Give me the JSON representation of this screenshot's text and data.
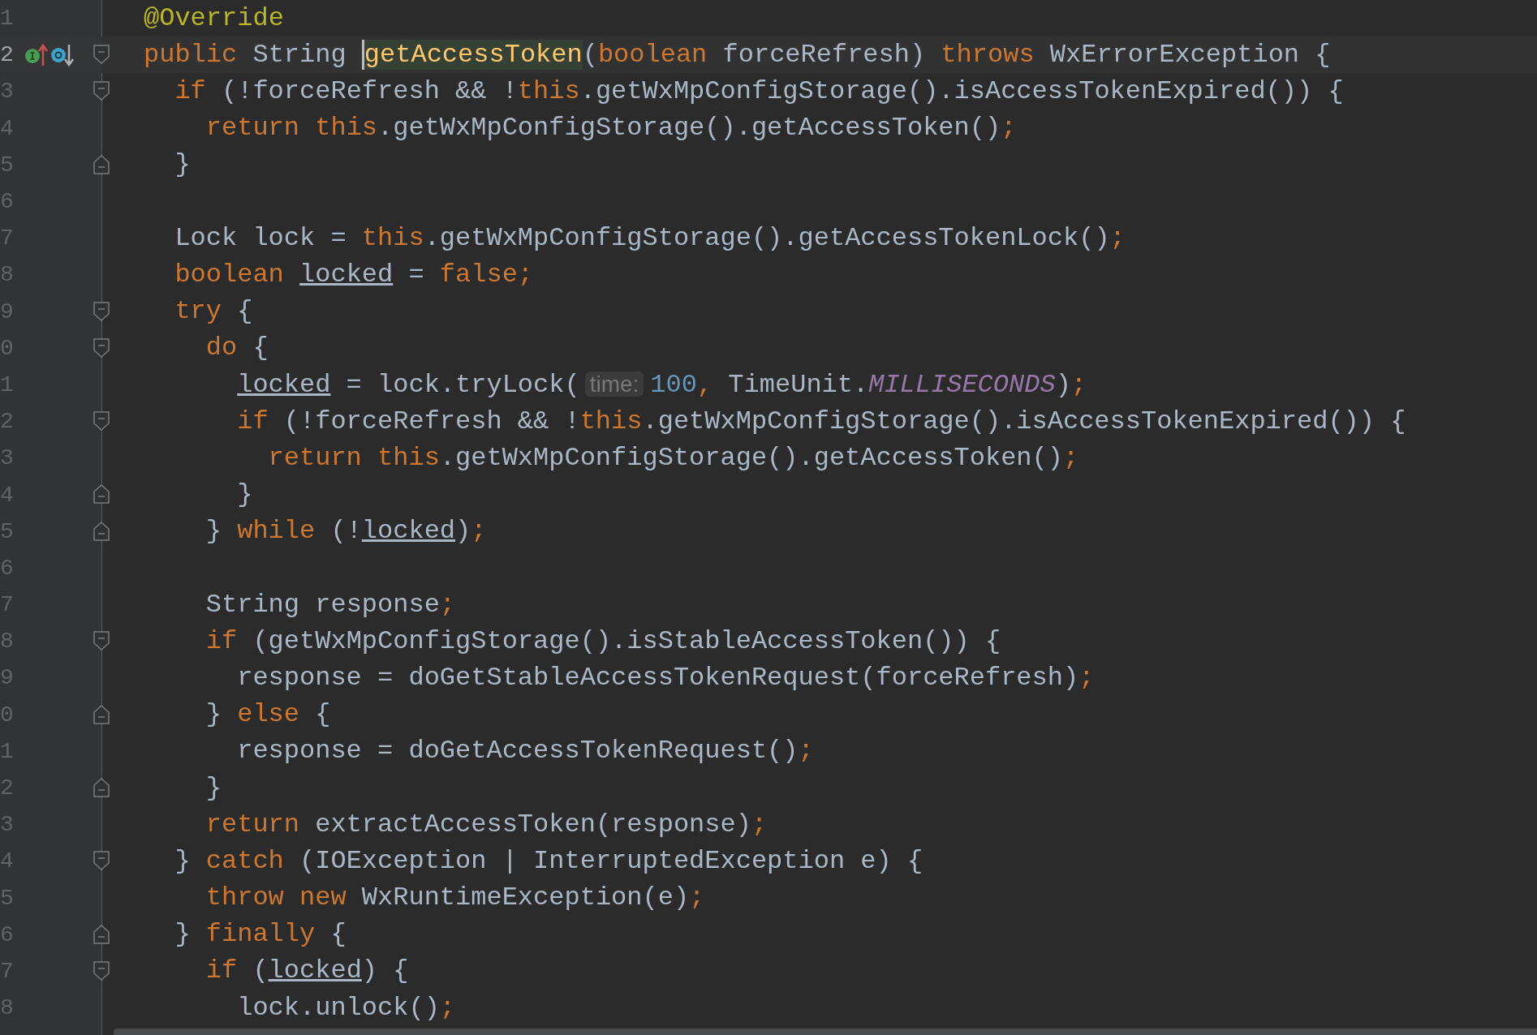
{
  "editor": {
    "lines": [
      {
        "number": "1",
        "tokens": [
          {
            "kind": "annotation",
            "text": "@Override"
          }
        ]
      },
      {
        "number": "2",
        "current": true,
        "fold_marker": {
          "kind": "start"
        },
        "gutter_icons": [
          {
            "kind": "implements"
          },
          {
            "kind": "overrides"
          }
        ],
        "tokens": [
          {
            "kind": "keyword",
            "text": "public "
          },
          {
            "kind": "plain",
            "text": "String "
          },
          {
            "kind": "declaration",
            "text": "getAccessToken"
          },
          {
            "kind": "plain",
            "text": "("
          },
          {
            "kind": "keyword",
            "text": "boolean "
          },
          {
            "kind": "plain",
            "text": "forceRefresh) "
          },
          {
            "kind": "keyword",
            "text": "throws "
          },
          {
            "kind": "plain",
            "text": "WxErrorException {"
          }
        ]
      },
      {
        "number": "3",
        "fold_marker": {
          "kind": "start"
        },
        "tokens": [
          {
            "kind": "keyword",
            "text": "if "
          },
          {
            "kind": "plain",
            "text": "(!forceRefresh && !"
          },
          {
            "kind": "keyword",
            "text": "this"
          },
          {
            "kind": "plain",
            "text": ".getWxMpConfigStorage().isAccessTokenExpired()) {"
          }
        ]
      },
      {
        "number": "4",
        "tokens": [
          {
            "kind": "keyword",
            "text": "return this"
          },
          {
            "kind": "plain",
            "text": ".getWxMpConfigStorage().getAccessToken()"
          },
          {
            "kind": "keyword",
            "text": ";"
          }
        ]
      },
      {
        "number": "5",
        "fold_marker": {
          "kind": "end"
        },
        "tokens": [
          {
            "kind": "plain",
            "text": "}"
          }
        ]
      },
      {
        "number": "6"
      },
      {
        "number": "7",
        "tokens": [
          {
            "kind": "plain",
            "text": "Lock lock = "
          },
          {
            "kind": "keyword",
            "text": "this"
          },
          {
            "kind": "plain",
            "text": ".getWxMpConfigStorage().getAccessTokenLock()"
          },
          {
            "kind": "keyword",
            "text": ";"
          }
        ]
      },
      {
        "number": "8",
        "tokens": [
          {
            "kind": "keyword",
            "text": "boolean "
          },
          {
            "kind": "reassigned",
            "text": "locked"
          },
          {
            "kind": "plain",
            "text": " = "
          },
          {
            "kind": "keyword",
            "text": "false;"
          }
        ]
      },
      {
        "number": "9",
        "fold_marker": {
          "kind": "start"
        },
        "tokens": [
          {
            "kind": "keyword",
            "text": "try "
          },
          {
            "kind": "plain",
            "text": "{"
          }
        ]
      },
      {
        "number": "0",
        "fold_marker": {
          "kind": "start"
        },
        "tokens": [
          {
            "kind": "keyword",
            "text": "do "
          },
          {
            "kind": "plain",
            "text": "{"
          }
        ]
      },
      {
        "number": "1",
        "tokens": [
          {
            "kind": "reassigned",
            "text": "locked"
          },
          {
            "kind": "plain",
            "text": " = lock.tryLock("
          },
          {
            "kind": "hint",
            "text": "time:"
          },
          {
            "kind": "number",
            "text": "100"
          },
          {
            "kind": "keyword",
            "text": ", "
          },
          {
            "kind": "plain",
            "text": "TimeUnit."
          },
          {
            "kind": "constant",
            "text": "MILLISECONDS"
          },
          {
            "kind": "plain",
            "text": ")"
          },
          {
            "kind": "keyword",
            "text": ";"
          }
        ]
      },
      {
        "number": "2",
        "fold_marker": {
          "kind": "start"
        },
        "tokens": [
          {
            "kind": "keyword",
            "text": "if "
          },
          {
            "kind": "plain",
            "text": "(!forceRefresh && !"
          },
          {
            "kind": "keyword",
            "text": "this"
          },
          {
            "kind": "plain",
            "text": ".getWxMpConfigStorage().isAccessTokenExpired()) {"
          }
        ]
      },
      {
        "number": "3",
        "tokens": [
          {
            "kind": "keyword",
            "text": "return this"
          },
          {
            "kind": "plain",
            "text": ".getWxMpConfigStorage().getAccessToken()"
          },
          {
            "kind": "keyword",
            "text": ";"
          }
        ]
      },
      {
        "number": "4",
        "fold_marker": {
          "kind": "end"
        },
        "tokens": [
          {
            "kind": "plain",
            "text": "}"
          }
        ]
      },
      {
        "number": "5",
        "fold_marker": {
          "kind": "end"
        },
        "tokens": [
          {
            "kind": "plain",
            "text": "} "
          },
          {
            "kind": "keyword",
            "text": "while "
          },
          {
            "kind": "plain",
            "text": "(!"
          },
          {
            "kind": "reassigned",
            "text": "locked"
          },
          {
            "kind": "plain",
            "text": ")"
          },
          {
            "kind": "keyword",
            "text": ";"
          }
        ]
      },
      {
        "number": "6"
      },
      {
        "number": "7",
        "tokens": [
          {
            "kind": "plain",
            "text": "String response"
          },
          {
            "kind": "keyword",
            "text": ";"
          }
        ]
      },
      {
        "number": "8",
        "fold_marker": {
          "kind": "start"
        },
        "tokens": [
          {
            "kind": "keyword",
            "text": "if "
          },
          {
            "kind": "plain",
            "text": "(getWxMpConfigStorage().isStableAccessToken()) {"
          }
        ]
      },
      {
        "number": "9",
        "tokens": [
          {
            "kind": "plain",
            "text": "response = doGetStableAccessTokenRequest(forceRefresh)"
          },
          {
            "kind": "keyword",
            "text": ";"
          }
        ]
      },
      {
        "number": "0",
        "fold_marker": {
          "kind": "end"
        },
        "tokens": [
          {
            "kind": "plain",
            "text": "} "
          },
          {
            "kind": "keyword",
            "text": "else "
          },
          {
            "kind": "plain",
            "text": "{"
          }
        ]
      },
      {
        "number": "1",
        "tokens": [
          {
            "kind": "plain",
            "text": "response = doGetAccessTokenRequest()"
          },
          {
            "kind": "keyword",
            "text": ";"
          }
        ]
      },
      {
        "number": "2",
        "fold_marker": {
          "kind": "end"
        },
        "tokens": [
          {
            "kind": "plain",
            "text": "}"
          }
        ]
      },
      {
        "number": "3",
        "tokens": [
          {
            "kind": "keyword",
            "text": "return "
          },
          {
            "kind": "plain",
            "text": "extractAccessToken(response)"
          },
          {
            "kind": "keyword",
            "text": ";"
          }
        ]
      },
      {
        "number": "4",
        "fold_marker": {
          "kind": "start"
        },
        "tokens": [
          {
            "kind": "plain",
            "text": "} "
          },
          {
            "kind": "keyword",
            "text": "catch "
          },
          {
            "kind": "plain",
            "text": "(IOException | InterruptedException e) {"
          }
        ]
      },
      {
        "number": "5",
        "tokens": [
          {
            "kind": "keyword",
            "text": "throw new "
          },
          {
            "kind": "plain",
            "text": "WxRuntimeException(e)"
          },
          {
            "kind": "keyword",
            "text": ";"
          }
        ]
      },
      {
        "number": "6",
        "fold_marker": {
          "kind": "end"
        },
        "tokens": [
          {
            "kind": "plain",
            "text": "} "
          },
          {
            "kind": "keyword",
            "text": "finally "
          },
          {
            "kind": "plain",
            "text": "{"
          }
        ]
      },
      {
        "number": "7",
        "fold_marker": {
          "kind": "start"
        },
        "tokens": [
          {
            "kind": "keyword",
            "text": "if "
          },
          {
            "kind": "plain",
            "text": "("
          },
          {
            "kind": "reassigned",
            "text": "locked"
          },
          {
            "kind": "plain",
            "text": ") {"
          }
        ]
      },
      {
        "number": "8",
        "tokens": [
          {
            "kind": "plain",
            "text": "lock.unlock()"
          },
          {
            "kind": "keyword",
            "text": ";"
          }
        ]
      }
    ]
  }
}
